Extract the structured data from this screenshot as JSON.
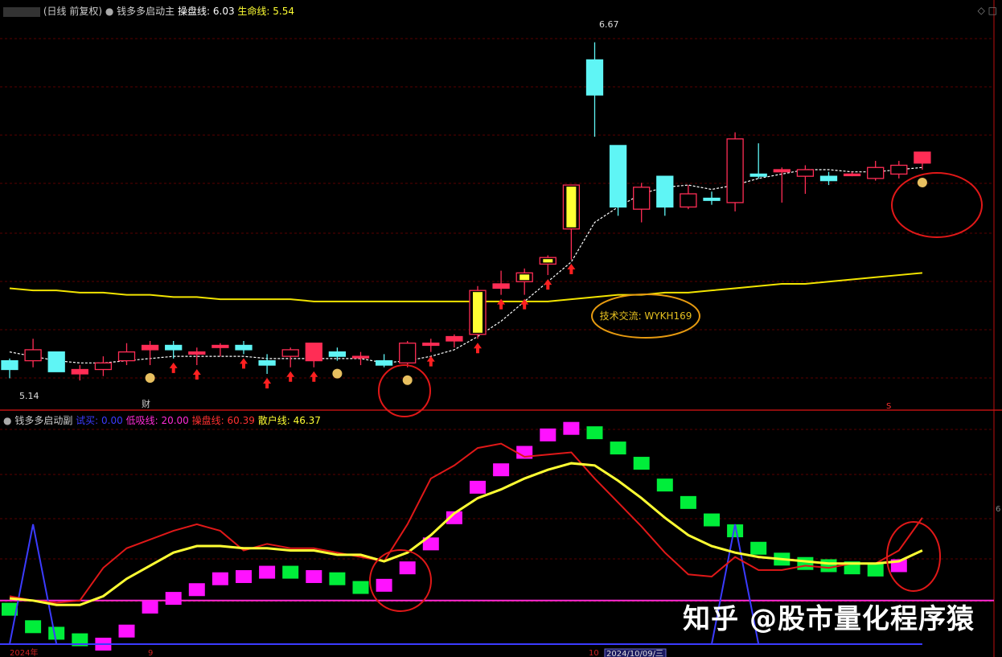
{
  "top_header": {
    "period": "(日线 前复权)",
    "indicator": "钱多多启动主",
    "line1_label": "操盘线:",
    "line1_value": "6.03",
    "line2_label": "生命线:",
    "line2_value": "5.54"
  },
  "bottom_header": {
    "indicator": "钱多多启动副",
    "items": [
      {
        "label": "试买:",
        "value": "0.00",
        "color": "#3b3bff"
      },
      {
        "label": "低吸线:",
        "value": "20.00",
        "color": "#ff2bd6"
      },
      {
        "label": "操盘线:",
        "value": "60.39",
        "color": "#ff3030"
      },
      {
        "label": "散户线:",
        "value": "46.37",
        "color": "#ffff33"
      }
    ]
  },
  "annotations": {
    "high_label": "6.67",
    "low_label": "5.14",
    "cai_marker": "财",
    "s_marker": "S",
    "tech_text": "技术交流: WYKH169",
    "right_edge_label": "6"
  },
  "axis_labels": {
    "date_start": "2024年",
    "month_9": "9",
    "month_10": "10",
    "date_box": "2024/10/09/三"
  },
  "watermark": "知乎 @股市量化程序猿",
  "colors": {
    "up": "#ff2d55",
    "down": "#5ff5f5",
    "highlight": "#ffff33",
    "ma": "#ffffff",
    "life": "#f2e400",
    "grid": "#5a0000",
    "circle": "#e01818",
    "oval": "#e69a10",
    "bar_up": "#ff12ff",
    "bar_down": "#00ee3a"
  },
  "chart_data": [
    {
      "type": "candlestick",
      "title": "钱多多启动主",
      "candles": [
        {
          "o": 5.22,
          "h": 5.23,
          "l": 5.14,
          "c": 5.18
        },
        {
          "o": 5.22,
          "h": 5.32,
          "l": 5.19,
          "c": 5.27
        },
        {
          "o": 5.26,
          "h": 5.26,
          "l": 5.17,
          "c": 5.17
        },
        {
          "o": 5.16,
          "h": 5.2,
          "l": 5.13,
          "c": 5.18
        },
        {
          "o": 5.18,
          "h": 5.24,
          "l": 5.15,
          "c": 5.21
        },
        {
          "o": 5.22,
          "h": 5.3,
          "l": 5.2,
          "c": 5.26
        },
        {
          "o": 5.27,
          "h": 5.31,
          "l": 5.2,
          "c": 5.29,
          "marker": "yellow"
        },
        {
          "o": 5.29,
          "h": 5.31,
          "l": 5.23,
          "c": 5.27
        },
        {
          "o": 5.25,
          "h": 5.28,
          "l": 5.2,
          "c": 5.26
        },
        {
          "o": 5.28,
          "h": 5.3,
          "l": 5.24,
          "c": 5.29
        },
        {
          "o": 5.29,
          "h": 5.31,
          "l": 5.25,
          "c": 5.27
        },
        {
          "o": 5.22,
          "h": 5.25,
          "l": 5.16,
          "c": 5.2
        },
        {
          "o": 5.24,
          "h": 5.28,
          "l": 5.19,
          "c": 5.27
        },
        {
          "o": 5.22,
          "h": 5.3,
          "l": 5.19,
          "c": 5.3
        },
        {
          "o": 5.26,
          "h": 5.28,
          "l": 5.22,
          "c": 5.24
        },
        {
          "o": 5.24,
          "h": 5.26,
          "l": 5.2,
          "c": 5.24
        },
        {
          "o": 5.22,
          "h": 5.25,
          "l": 5.19,
          "c": 5.2
        },
        {
          "o": 5.21,
          "h": 5.31,
          "l": 5.19,
          "c": 5.3
        },
        {
          "o": 5.29,
          "h": 5.32,
          "l": 5.26,
          "c": 5.3
        },
        {
          "o": 5.31,
          "h": 5.34,
          "l": 5.28,
          "c": 5.33
        },
        {
          "o": 5.34,
          "h": 5.56,
          "l": 5.32,
          "c": 5.54
        },
        {
          "o": 5.55,
          "h": 5.63,
          "l": 5.52,
          "c": 5.57
        },
        {
          "o": 5.58,
          "h": 5.64,
          "l": 5.52,
          "c": 5.62
        },
        {
          "o": 5.66,
          "h": 5.7,
          "l": 5.61,
          "c": 5.69
        },
        {
          "o": 5.82,
          "h": 6.02,
          "l": 5.68,
          "c": 6.02
        },
        {
          "o": 6.59,
          "h": 6.67,
          "l": 6.24,
          "c": 6.43
        },
        {
          "o": 6.2,
          "h": 6.2,
          "l": 5.88,
          "c": 5.92
        },
        {
          "o": 5.91,
          "h": 6.03,
          "l": 5.85,
          "c": 6.01
        },
        {
          "o": 6.06,
          "h": 6.06,
          "l": 5.88,
          "c": 5.92
        },
        {
          "o": 5.92,
          "h": 6.02,
          "l": 5.91,
          "c": 5.98
        },
        {
          "o": 5.96,
          "h": 5.99,
          "l": 5.93,
          "c": 5.95
        },
        {
          "o": 5.94,
          "h": 6.26,
          "l": 5.9,
          "c": 6.23
        },
        {
          "o": 6.07,
          "h": 6.21,
          "l": 6.05,
          "c": 6.06
        },
        {
          "o": 6.08,
          "h": 6.1,
          "l": 5.94,
          "c": 6.09
        },
        {
          "o": 6.06,
          "h": 6.11,
          "l": 5.98,
          "c": 6.09
        },
        {
          "o": 6.06,
          "h": 6.08,
          "l": 6.02,
          "c": 6.04
        },
        {
          "o": 6.07,
          "h": 6.08,
          "l": 6.06,
          "c": 6.07
        },
        {
          "o": 6.05,
          "h": 6.13,
          "l": 6.04,
          "c": 6.1
        },
        {
          "o": 6.07,
          "h": 6.13,
          "l": 6.05,
          "c": 6.11
        },
        {
          "o": 6.12,
          "h": 6.17,
          "l": 6.09,
          "c": 6.17
        }
      ],
      "ma_line": [
        5.26,
        5.24,
        5.22,
        5.21,
        5.21,
        5.22,
        5.23,
        5.24,
        5.24,
        5.24,
        5.24,
        5.23,
        5.23,
        5.23,
        5.23,
        5.23,
        5.21,
        5.22,
        5.24,
        5.27,
        5.33,
        5.4,
        5.49,
        5.58,
        5.67,
        5.85,
        5.92,
        5.98,
        6.01,
        6.02,
        6.0,
        6.02,
        6.05,
        6.07,
        6.09,
        6.09,
        6.08,
        6.08,
        6.09,
        6.1
      ],
      "life_line": [
        5.55,
        5.54,
        5.54,
        5.53,
        5.53,
        5.52,
        5.52,
        5.51,
        5.51,
        5.5,
        5.5,
        5.5,
        5.5,
        5.49,
        5.49,
        5.49,
        5.49,
        5.49,
        5.49,
        5.49,
        5.49,
        5.49,
        5.49,
        5.49,
        5.5,
        5.51,
        5.52,
        5.52,
        5.53,
        5.53,
        5.54,
        5.55,
        5.56,
        5.57,
        5.57,
        5.58,
        5.59,
        5.6,
        5.61,
        5.62
      ],
      "ylim": [
        5.05,
        6.76
      ],
      "money_bags": [
        6,
        14,
        17,
        39
      ],
      "arrows": [
        7,
        8,
        10,
        11,
        12,
        13,
        18,
        20,
        21,
        22,
        23,
        24
      ]
    },
    {
      "type": "line+bar",
      "title": "钱多多启动副",
      "ylim": [
        0,
        100
      ],
      "bars": [
        {
          "v": 16,
          "c": "g"
        },
        {
          "v": 8,
          "c": "g"
        },
        {
          "v": 5,
          "c": "g"
        },
        {
          "v": 2,
          "c": "g"
        },
        {
          "v": 0,
          "c": "m"
        },
        {
          "v": 6,
          "c": "m"
        },
        {
          "v": 17,
          "c": "m"
        },
        {
          "v": 21,
          "c": "m"
        },
        {
          "v": 25,
          "c": "m"
        },
        {
          "v": 30,
          "c": "m"
        },
        {
          "v": 31,
          "c": "m"
        },
        {
          "v": 33,
          "c": "m"
        },
        {
          "v": 33,
          "c": "g"
        },
        {
          "v": 31,
          "c": "m"
        },
        {
          "v": 30,
          "c": "g"
        },
        {
          "v": 26,
          "c": "g"
        },
        {
          "v": 27,
          "c": "m"
        },
        {
          "v": 35,
          "c": "m"
        },
        {
          "v": 46,
          "c": "m"
        },
        {
          "v": 58,
          "c": "m"
        },
        {
          "v": 72,
          "c": "m"
        },
        {
          "v": 80,
          "c": "m"
        },
        {
          "v": 88,
          "c": "m"
        },
        {
          "v": 96,
          "c": "m"
        },
        {
          "v": 99,
          "c": "m"
        },
        {
          "v": 97,
          "c": "g"
        },
        {
          "v": 90,
          "c": "g"
        },
        {
          "v": 83,
          "c": "g"
        },
        {
          "v": 73,
          "c": "g"
        },
        {
          "v": 65,
          "c": "g"
        },
        {
          "v": 57,
          "c": "g"
        },
        {
          "v": 52,
          "c": "g"
        },
        {
          "v": 44,
          "c": "g"
        },
        {
          "v": 39,
          "c": "g"
        },
        {
          "v": 37,
          "c": "g"
        },
        {
          "v": 36,
          "c": "g"
        },
        {
          "v": 35,
          "c": "g"
        },
        {
          "v": 34,
          "c": "g"
        },
        {
          "v": 36,
          "c": "m"
        }
      ],
      "red_line": [
        22,
        20,
        19,
        20,
        35,
        44,
        48,
        52,
        55,
        52,
        43,
        46,
        44,
        44,
        42,
        40,
        38,
        55,
        76,
        82,
        90,
        92,
        86,
        87,
        88,
        76,
        65,
        54,
        42,
        32,
        31,
        40,
        34,
        34,
        36,
        35,
        37,
        37,
        43,
        58
      ],
      "yellow_line": [
        21,
        20,
        18,
        18,
        22,
        30,
        36,
        42,
        45,
        45,
        44,
        44,
        43,
        43,
        41,
        41,
        38,
        42,
        50,
        60,
        67,
        71,
        76,
        80,
        83,
        82,
        75,
        67,
        58,
        50,
        45,
        42,
        40,
        39,
        38,
        37,
        37,
        37,
        38,
        43
      ],
      "blue_line": [
        0,
        55,
        0,
        0,
        0,
        0,
        0,
        0,
        0,
        0,
        0,
        0,
        0,
        0,
        0,
        0,
        0,
        0,
        0,
        0,
        0,
        0,
        0,
        0,
        0,
        0,
        0,
        0,
        0,
        0,
        0,
        55,
        0,
        0,
        0,
        0,
        0,
        0,
        0,
        0
      ],
      "pink_line": 20
    }
  ]
}
